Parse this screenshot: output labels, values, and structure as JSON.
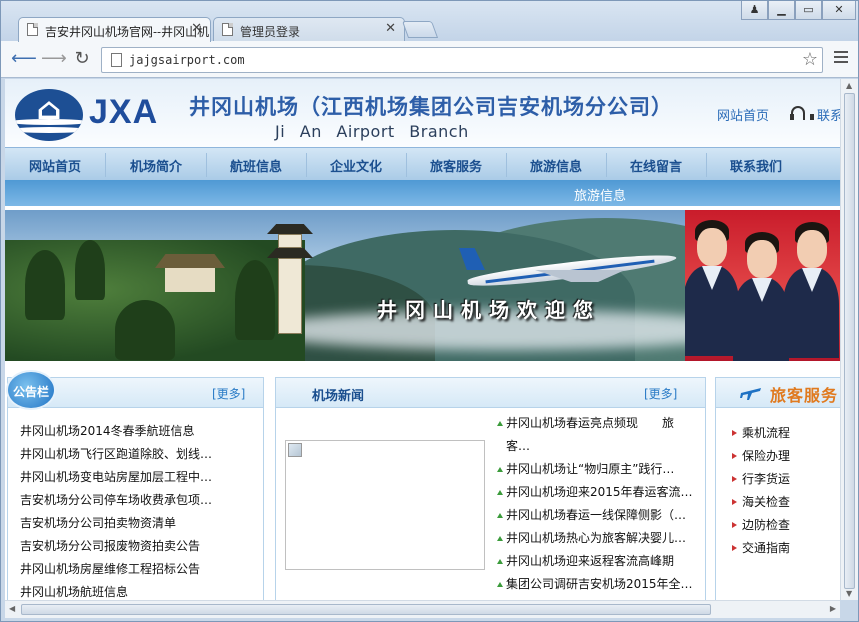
{
  "browser": {
    "tabs": [
      {
        "title": "吉安井冈山机场官网--井冈山机",
        "active": true
      },
      {
        "title": "管理员登录",
        "active": false
      }
    ],
    "url": "jajgsairport.com",
    "icons": {
      "back": "back-arrow-icon",
      "forward": "forward-arrow-icon",
      "reload": "reload-icon",
      "bookmark": "star-icon",
      "menu": "hamburger-menu-icon",
      "tab_close": "close-icon"
    }
  },
  "site": {
    "logo_text": "JXA",
    "title_cn": "井冈山机场（江西机场集团公司吉安机场分公司）",
    "title_en": "Ji An Airport Branch",
    "header_links": [
      "网站首页",
      "联系"
    ]
  },
  "nav": {
    "items": [
      "网站首页",
      "机场简介",
      "航班信息",
      "企业文化",
      "旅客服务",
      "旅游信息",
      "在线留言",
      "联系我们"
    ],
    "sub_label": "旅游信息"
  },
  "banner": {
    "text": "井冈山机场欢迎您"
  },
  "notice": {
    "badge": "公告栏",
    "more": "[更多]",
    "items": [
      "井冈山机场2014冬春季航班信息",
      "井冈山机场飞行区跑道除胶、划线…",
      "井冈山机场变电站房屋加层工程中…",
      "吉安机场分公司停车场收费承包项…",
      "吉安机场分公司拍卖物资清单",
      "吉安机场分公司报废物资拍卖公告",
      "井冈山机场房屋维修工程招标公告",
      "井冈山机场航班信息"
    ]
  },
  "news": {
    "title": "机场新闻",
    "more": "[更多]",
    "items": [
      "井冈山机场春运亮点频现　　旅客…",
      "井冈山机场让“物归原主”践行…",
      "井冈山机场迎来2015年春运客流…",
      "井冈山机场春运一线保障侧影（…",
      "井冈山机场热心为旅客解决婴儿…",
      "井冈山机场迎来返程客流高峰期",
      "集团公司调研吉安机场2015年全…"
    ]
  },
  "service": {
    "title": "旅客服务",
    "items": [
      "乘机流程",
      "保险办理",
      "行李货运",
      "海关检查",
      "边防检查",
      "交通指南"
    ]
  }
}
